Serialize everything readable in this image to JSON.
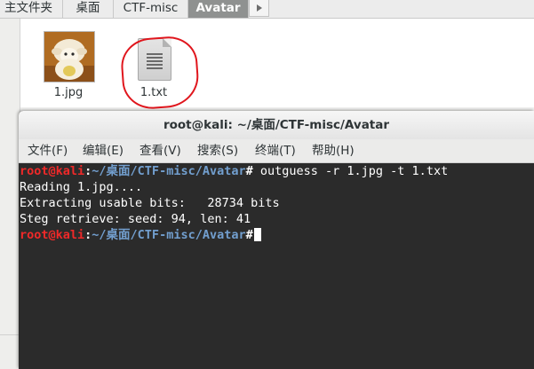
{
  "file_manager": {
    "breadcrumbs": [
      {
        "label": "主文件夹"
      },
      {
        "label": "桌面"
      },
      {
        "label": "CTF-misc"
      },
      {
        "label": "Avatar",
        "active": true
      }
    ],
    "files": [
      {
        "name": "1.jpg",
        "type": "image"
      },
      {
        "name": "1.txt",
        "type": "text"
      }
    ]
  },
  "terminal": {
    "title": "root@kali: ~/桌面/CTF-misc/Avatar",
    "menu": [
      "文件(F)",
      "编辑(E)",
      "查看(V)",
      "搜索(S)",
      "终端(T)",
      "帮助(H)"
    ],
    "prompt": {
      "user_host": "root@kali",
      "sep": ":",
      "path": "~/桌面/CTF-misc/Avatar",
      "symbol": "#"
    },
    "command": " outguess -r 1.jpg -t 1.txt",
    "output": [
      "Reading 1.jpg....",
      "Extracting usable bits:   28734 bits",
      "Steg retrieve: seed: 94, len: 41"
    ]
  },
  "colors": {
    "annotation_red": "#e0161d",
    "prompt_user": "#ef2929",
    "prompt_path": "#729fcf",
    "terminal_bg": "#2b2b2b"
  }
}
